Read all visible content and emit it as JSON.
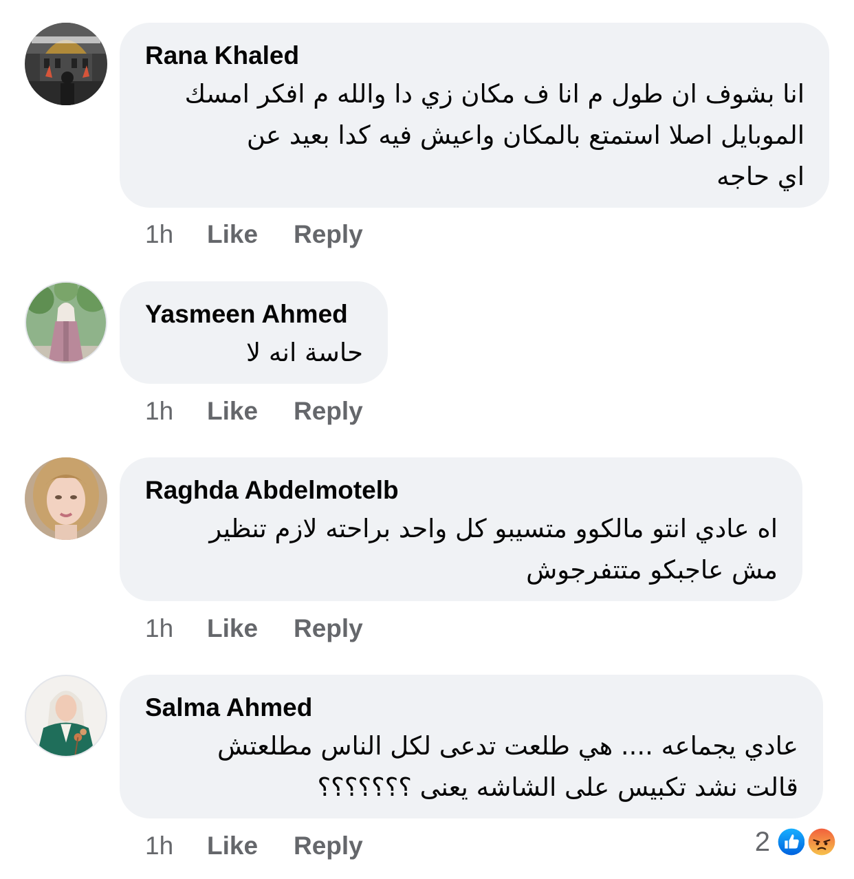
{
  "colors": {
    "bubble_bg": "#f0f2f5",
    "meta_text": "#65676b",
    "like_blue": "#1877f2",
    "angry_top": "#f2603c",
    "angry_bottom": "#f6c14c"
  },
  "comments": [
    {
      "author": "Rana Khaled",
      "lines": [
        "انا بشوف ان طول م انا ف مكان زي دا والله م افكر امسك",
        "الموبايل اصلا استمتع بالمكان واعيش فيه كدا بعيد عن",
        "اي حاجه"
      ],
      "time": "1h",
      "like_label": "Like",
      "reply_label": "Reply",
      "avatar_icon": "profile-photo-mosque"
    },
    {
      "author": "Yasmeen Ahmed",
      "lines": [
        "حاسة انه لا"
      ],
      "time": "1h",
      "like_label": "Like",
      "reply_label": "Reply",
      "avatar_icon": "profile-photo-garden"
    },
    {
      "author": "Raghda Abdelmotelb",
      "lines": [
        "اه عادي انتو مالكوو متسيبو كل واحد براحته لازم تنظير",
        "مش عاجبكو متتفرجوش"
      ],
      "time": "1h",
      "like_label": "Like",
      "reply_label": "Reply",
      "avatar_icon": "profile-photo-portrait"
    },
    {
      "author": "Salma Ahmed",
      "lines": [
        "عادي يجماعه .... هي طلعت تدعى لكل الناس مطلعتش",
        "قالت نشد تكبيس على الشاشه يعنى ؟؟؟؟؟؟؟"
      ],
      "time": "1h",
      "like_label": "Like",
      "reply_label": "Reply",
      "avatar_icon": "profile-photo-hijab",
      "reaction_count": "2",
      "reaction_icons": [
        "like-reaction-icon",
        "angry-reaction-icon"
      ]
    }
  ]
}
